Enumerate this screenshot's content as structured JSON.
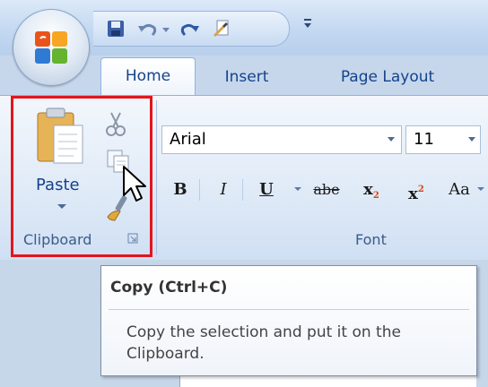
{
  "icons": {
    "office": "office-logo-icon",
    "save": "save-icon",
    "undo": "undo-icon",
    "redo": "redo-icon",
    "customize": "customize-quick-access-icon",
    "paste": "paste-clipboard-icon",
    "cut": "scissors-icon",
    "copy": "copy-icon",
    "format_painter": "format-painter-brush-icon",
    "cursor": "mouse-pointer-icon",
    "launcher": "dialog-launcher-icon"
  },
  "tabs": [
    {
      "label": "Home",
      "active": true
    },
    {
      "label": "Insert",
      "active": false
    },
    {
      "label": "Page Layout",
      "active": false
    }
  ],
  "clipboard_group": {
    "paste_label": "Paste",
    "group_label": "Clipboard"
  },
  "font_group": {
    "font_name": "Arial",
    "font_size": "11",
    "bold": "B",
    "italic": "I",
    "underline": "U",
    "strikethrough": "abe",
    "subscript": "x",
    "subscript_mark": "2",
    "superscript": "x",
    "superscript_mark": "2",
    "change_case": "Aa",
    "group_label": "Font"
  },
  "tooltip": {
    "title": "Copy (Ctrl+C)",
    "description": "Copy the selection and put it on the Clipboard."
  },
  "colors": {
    "highlight_box": "#e3151d",
    "ribbon_text": "#15428b"
  }
}
